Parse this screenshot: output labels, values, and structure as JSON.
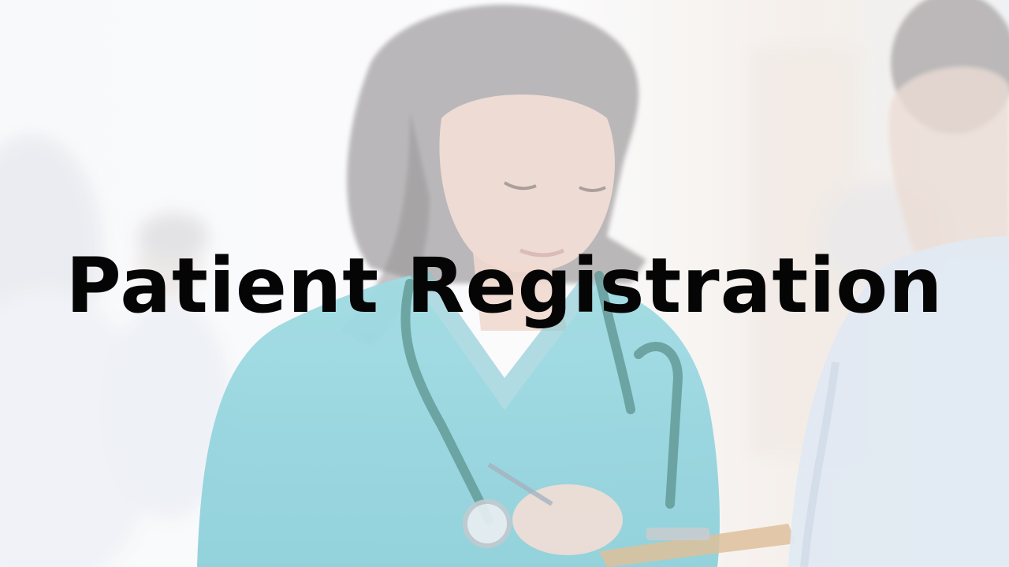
{
  "slide": {
    "title": "Patient Registration"
  },
  "background": {
    "subject": "nurse-with-clipboard-and-stethoscope",
    "colors": {
      "scrubs": "#8fd3dc",
      "stethoscope": "#4c8a86",
      "hair": "#7d7a7c",
      "skin": "#efd7cd",
      "backdrop": "#f7f8fa",
      "patient_shirt": "#dfe7f2"
    }
  }
}
